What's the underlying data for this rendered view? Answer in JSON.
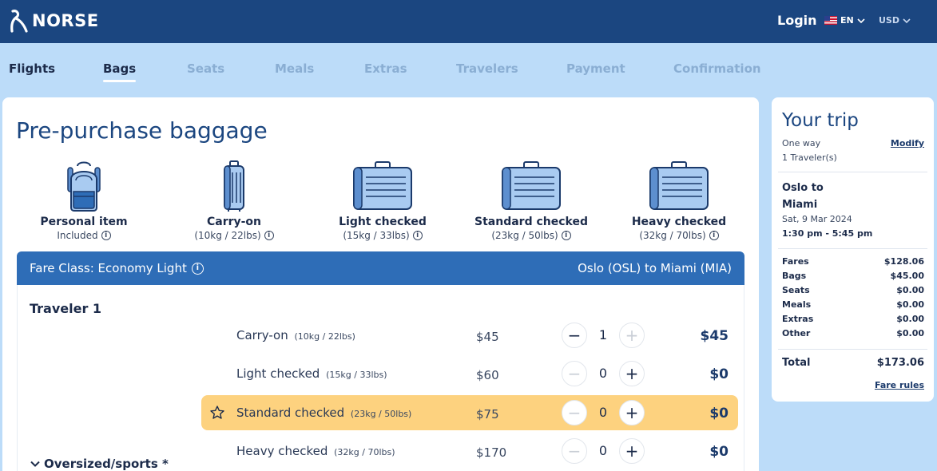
{
  "header": {
    "brand": "NORSE",
    "login_label": "Login",
    "language": "EN",
    "currency": "USD"
  },
  "steps": [
    {
      "label": "Flights",
      "state": "done"
    },
    {
      "label": "Bags",
      "state": "active"
    },
    {
      "label": "Seats",
      "state": "upcoming"
    },
    {
      "label": "Meals",
      "state": "upcoming"
    },
    {
      "label": "Extras",
      "state": "upcoming"
    },
    {
      "label": "Travelers",
      "state": "upcoming"
    },
    {
      "label": "Payment",
      "state": "upcoming"
    },
    {
      "label": "Confirmation",
      "state": "upcoming"
    }
  ],
  "main": {
    "title": "Pre-purchase baggage",
    "bag_types": [
      {
        "name": "Personal item",
        "sub": "Included",
        "icon": "backpack-icon"
      },
      {
        "name": "Carry-on",
        "sub": "(10kg / 22lbs)",
        "icon": "carry-on-suitcase-icon"
      },
      {
        "name": "Light checked",
        "sub": "(15kg / 33lbs)",
        "icon": "checked-suitcase-icon"
      },
      {
        "name": "Standard checked",
        "sub": "(23kg / 50lbs)",
        "icon": "checked-suitcase-icon"
      },
      {
        "name": "Heavy checked",
        "sub": "(32kg / 70lbs)",
        "icon": "checked-suitcase-icon"
      }
    ],
    "fare_class": "Fare Class: Economy Light",
    "route": "Oslo (OSL) to Miami (MIA)",
    "traveler": "Traveler 1",
    "rows": [
      {
        "name": "Carry-on",
        "weight": "(10kg / 22lbs)",
        "price": "$45",
        "qty": "1",
        "total": "$45",
        "highlight": false,
        "minus_enabled": true,
        "plus_enabled": false
      },
      {
        "name": "Light checked",
        "weight": "(15kg / 33lbs)",
        "price": "$60",
        "qty": "0",
        "total": "$0",
        "highlight": false,
        "minus_enabled": false,
        "plus_enabled": true
      },
      {
        "name": "Standard checked",
        "weight": "(23kg / 50lbs)",
        "price": "$75",
        "qty": "0",
        "total": "$0",
        "highlight": true,
        "minus_enabled": false,
        "plus_enabled": true
      },
      {
        "name": "Heavy checked",
        "weight": "(32kg / 70lbs)",
        "price": "$170",
        "qty": "0",
        "total": "$0",
        "highlight": false,
        "minus_enabled": false,
        "plus_enabled": true
      }
    ],
    "oversized_label": "Oversized/sports *"
  },
  "trip": {
    "title": "Your trip",
    "modify_label": "Modify",
    "trip_type": "One way",
    "travelers": "1 Traveler(s)",
    "from": "Oslo to",
    "to": "Miami",
    "date": "Sat, 9 Mar 2024",
    "time": "1:30 pm - 5:45 pm",
    "costs": [
      {
        "label": "Fares",
        "value": "$128.06"
      },
      {
        "label": "Bags",
        "value": "$45.00"
      },
      {
        "label": "Seats",
        "value": "$0.00"
      },
      {
        "label": "Meals",
        "value": "$0.00"
      },
      {
        "label": "Extras",
        "value": "$0.00"
      },
      {
        "label": "Other",
        "value": "$0.00"
      }
    ],
    "total_label": "Total",
    "total_value": "$173.06",
    "fare_rules_label": "Fare rules"
  },
  "colors": {
    "header_bg": "#1b4680",
    "page_bg": "#bcdcf9",
    "fare_bar": "#2e6db7",
    "highlight": "#fdd27f"
  }
}
